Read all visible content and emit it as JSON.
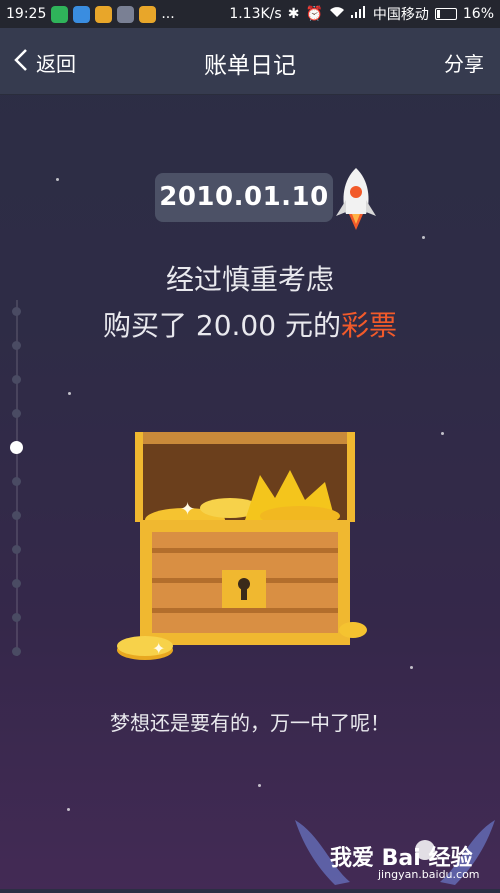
{
  "status_bar": {
    "time": "19:25",
    "more": "...",
    "speed": "1.13K/s",
    "carrier": "中国移动",
    "battery": "16%"
  },
  "nav": {
    "back_label": "返回",
    "title": "账单日记",
    "share_label": "分享"
  },
  "entry": {
    "date": "2010.01.10",
    "line1": "经过慎重考虑",
    "line2_prefix": "购买了 20.00 元的",
    "line2_highlight": "彩票",
    "tagline": "梦想还是要有的，万一中了呢！"
  },
  "watermark": {
    "text": "我爱 Bai 经验",
    "url": "jingyan.baidu.com"
  },
  "colors": {
    "highlight": "#f25a2a",
    "date_pill": "#4c5166",
    "nav_bar": "#363b4f"
  }
}
